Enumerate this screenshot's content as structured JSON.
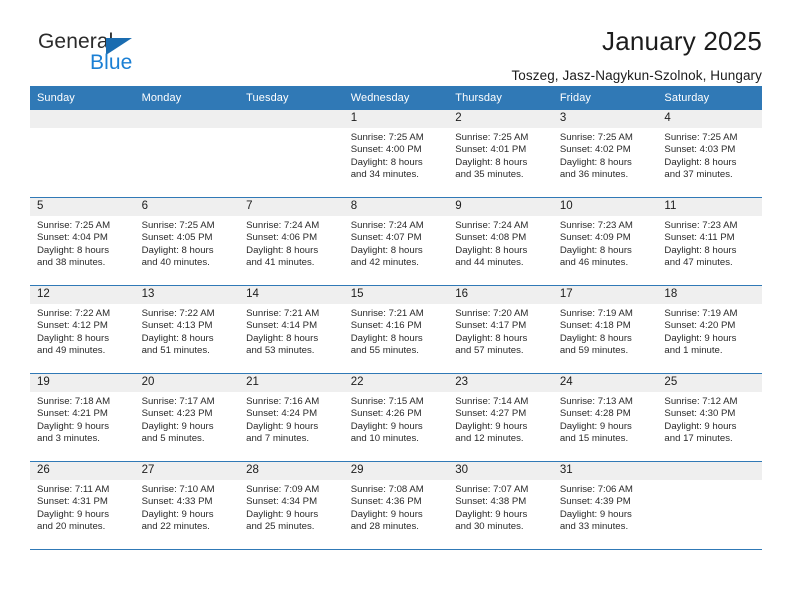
{
  "brand": {
    "word1": "General",
    "word2": "Blue",
    "triangle_color": "#1a6cb0",
    "blue_text_color": "#1a7fd4"
  },
  "header": {
    "title": "January 2025",
    "subtitle": "Toszeg, Jasz-Nagykun-Szolnok, Hungary"
  },
  "theme": {
    "header_row_bg": "#3079b6",
    "daynum_band_bg": "#efefef",
    "row_divider": "#3079b6"
  },
  "weekdays": [
    "Sunday",
    "Monday",
    "Tuesday",
    "Wednesday",
    "Thursday",
    "Friday",
    "Saturday"
  ],
  "weeks": [
    [
      {
        "day": "",
        "sunrise": "",
        "sunset": "",
        "daylight1": "",
        "daylight2": ""
      },
      {
        "day": "",
        "sunrise": "",
        "sunset": "",
        "daylight1": "",
        "daylight2": ""
      },
      {
        "day": "",
        "sunrise": "",
        "sunset": "",
        "daylight1": "",
        "daylight2": ""
      },
      {
        "day": "1",
        "sunrise": "Sunrise: 7:25 AM",
        "sunset": "Sunset: 4:00 PM",
        "daylight1": "Daylight: 8 hours",
        "daylight2": "and 34 minutes."
      },
      {
        "day": "2",
        "sunrise": "Sunrise: 7:25 AM",
        "sunset": "Sunset: 4:01 PM",
        "daylight1": "Daylight: 8 hours",
        "daylight2": "and 35 minutes."
      },
      {
        "day": "3",
        "sunrise": "Sunrise: 7:25 AM",
        "sunset": "Sunset: 4:02 PM",
        "daylight1": "Daylight: 8 hours",
        "daylight2": "and 36 minutes."
      },
      {
        "day": "4",
        "sunrise": "Sunrise: 7:25 AM",
        "sunset": "Sunset: 4:03 PM",
        "daylight1": "Daylight: 8 hours",
        "daylight2": "and 37 minutes."
      }
    ],
    [
      {
        "day": "5",
        "sunrise": "Sunrise: 7:25 AM",
        "sunset": "Sunset: 4:04 PM",
        "daylight1": "Daylight: 8 hours",
        "daylight2": "and 38 minutes."
      },
      {
        "day": "6",
        "sunrise": "Sunrise: 7:25 AM",
        "sunset": "Sunset: 4:05 PM",
        "daylight1": "Daylight: 8 hours",
        "daylight2": "and 40 minutes."
      },
      {
        "day": "7",
        "sunrise": "Sunrise: 7:24 AM",
        "sunset": "Sunset: 4:06 PM",
        "daylight1": "Daylight: 8 hours",
        "daylight2": "and 41 minutes."
      },
      {
        "day": "8",
        "sunrise": "Sunrise: 7:24 AM",
        "sunset": "Sunset: 4:07 PM",
        "daylight1": "Daylight: 8 hours",
        "daylight2": "and 42 minutes."
      },
      {
        "day": "9",
        "sunrise": "Sunrise: 7:24 AM",
        "sunset": "Sunset: 4:08 PM",
        "daylight1": "Daylight: 8 hours",
        "daylight2": "and 44 minutes."
      },
      {
        "day": "10",
        "sunrise": "Sunrise: 7:23 AM",
        "sunset": "Sunset: 4:09 PM",
        "daylight1": "Daylight: 8 hours",
        "daylight2": "and 46 minutes."
      },
      {
        "day": "11",
        "sunrise": "Sunrise: 7:23 AM",
        "sunset": "Sunset: 4:11 PM",
        "daylight1": "Daylight: 8 hours",
        "daylight2": "and 47 minutes."
      }
    ],
    [
      {
        "day": "12",
        "sunrise": "Sunrise: 7:22 AM",
        "sunset": "Sunset: 4:12 PM",
        "daylight1": "Daylight: 8 hours",
        "daylight2": "and 49 minutes."
      },
      {
        "day": "13",
        "sunrise": "Sunrise: 7:22 AM",
        "sunset": "Sunset: 4:13 PM",
        "daylight1": "Daylight: 8 hours",
        "daylight2": "and 51 minutes."
      },
      {
        "day": "14",
        "sunrise": "Sunrise: 7:21 AM",
        "sunset": "Sunset: 4:14 PM",
        "daylight1": "Daylight: 8 hours",
        "daylight2": "and 53 minutes."
      },
      {
        "day": "15",
        "sunrise": "Sunrise: 7:21 AM",
        "sunset": "Sunset: 4:16 PM",
        "daylight1": "Daylight: 8 hours",
        "daylight2": "and 55 minutes."
      },
      {
        "day": "16",
        "sunrise": "Sunrise: 7:20 AM",
        "sunset": "Sunset: 4:17 PM",
        "daylight1": "Daylight: 8 hours",
        "daylight2": "and 57 minutes."
      },
      {
        "day": "17",
        "sunrise": "Sunrise: 7:19 AM",
        "sunset": "Sunset: 4:18 PM",
        "daylight1": "Daylight: 8 hours",
        "daylight2": "and 59 minutes."
      },
      {
        "day": "18",
        "sunrise": "Sunrise: 7:19 AM",
        "sunset": "Sunset: 4:20 PM",
        "daylight1": "Daylight: 9 hours",
        "daylight2": "and 1 minute."
      }
    ],
    [
      {
        "day": "19",
        "sunrise": "Sunrise: 7:18 AM",
        "sunset": "Sunset: 4:21 PM",
        "daylight1": "Daylight: 9 hours",
        "daylight2": "and 3 minutes."
      },
      {
        "day": "20",
        "sunrise": "Sunrise: 7:17 AM",
        "sunset": "Sunset: 4:23 PM",
        "daylight1": "Daylight: 9 hours",
        "daylight2": "and 5 minutes."
      },
      {
        "day": "21",
        "sunrise": "Sunrise: 7:16 AM",
        "sunset": "Sunset: 4:24 PM",
        "daylight1": "Daylight: 9 hours",
        "daylight2": "and 7 minutes."
      },
      {
        "day": "22",
        "sunrise": "Sunrise: 7:15 AM",
        "sunset": "Sunset: 4:26 PM",
        "daylight1": "Daylight: 9 hours",
        "daylight2": "and 10 minutes."
      },
      {
        "day": "23",
        "sunrise": "Sunrise: 7:14 AM",
        "sunset": "Sunset: 4:27 PM",
        "daylight1": "Daylight: 9 hours",
        "daylight2": "and 12 minutes."
      },
      {
        "day": "24",
        "sunrise": "Sunrise: 7:13 AM",
        "sunset": "Sunset: 4:28 PM",
        "daylight1": "Daylight: 9 hours",
        "daylight2": "and 15 minutes."
      },
      {
        "day": "25",
        "sunrise": "Sunrise: 7:12 AM",
        "sunset": "Sunset: 4:30 PM",
        "daylight1": "Daylight: 9 hours",
        "daylight2": "and 17 minutes."
      }
    ],
    [
      {
        "day": "26",
        "sunrise": "Sunrise: 7:11 AM",
        "sunset": "Sunset: 4:31 PM",
        "daylight1": "Daylight: 9 hours",
        "daylight2": "and 20 minutes."
      },
      {
        "day": "27",
        "sunrise": "Sunrise: 7:10 AM",
        "sunset": "Sunset: 4:33 PM",
        "daylight1": "Daylight: 9 hours",
        "daylight2": "and 22 minutes."
      },
      {
        "day": "28",
        "sunrise": "Sunrise: 7:09 AM",
        "sunset": "Sunset: 4:34 PM",
        "daylight1": "Daylight: 9 hours",
        "daylight2": "and 25 minutes."
      },
      {
        "day": "29",
        "sunrise": "Sunrise: 7:08 AM",
        "sunset": "Sunset: 4:36 PM",
        "daylight1": "Daylight: 9 hours",
        "daylight2": "and 28 minutes."
      },
      {
        "day": "30",
        "sunrise": "Sunrise: 7:07 AM",
        "sunset": "Sunset: 4:38 PM",
        "daylight1": "Daylight: 9 hours",
        "daylight2": "and 30 minutes."
      },
      {
        "day": "31",
        "sunrise": "Sunrise: 7:06 AM",
        "sunset": "Sunset: 4:39 PM",
        "daylight1": "Daylight: 9 hours",
        "daylight2": "and 33 minutes."
      },
      {
        "day": "",
        "sunrise": "",
        "sunset": "",
        "daylight1": "",
        "daylight2": ""
      }
    ]
  ]
}
